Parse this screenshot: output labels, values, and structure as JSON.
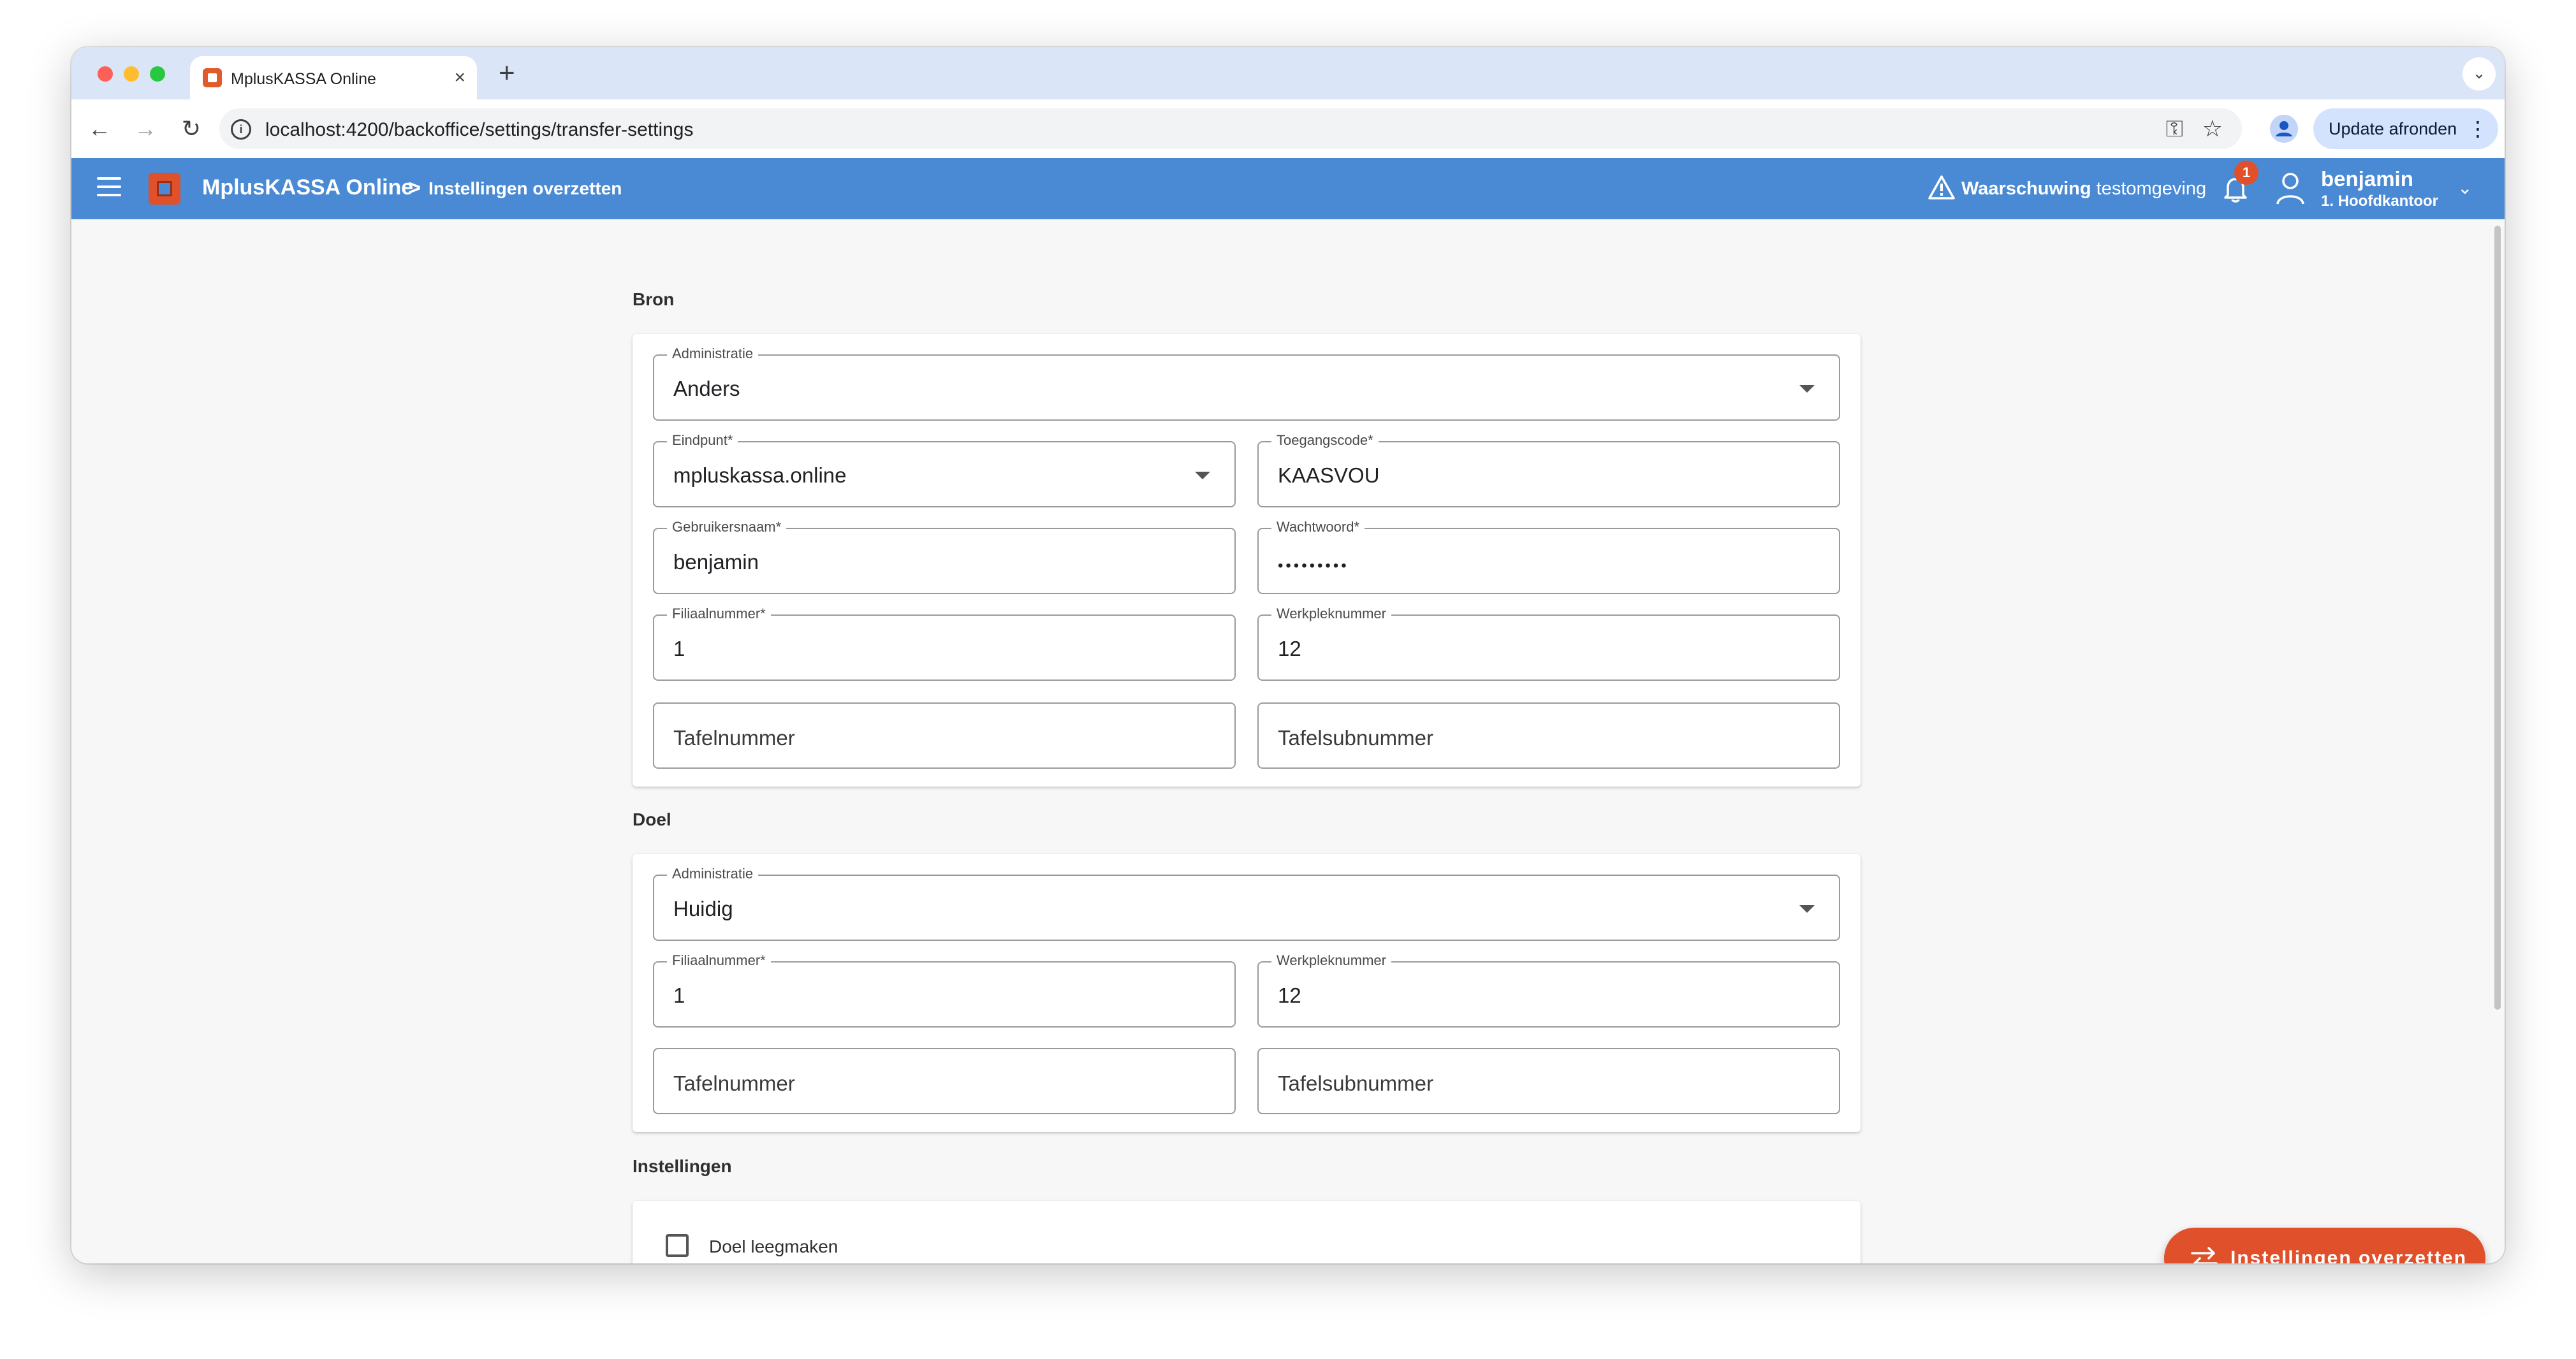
{
  "browser": {
    "tab_title": "MplusKASSA Online",
    "tab_close": "×",
    "new_tab": "+",
    "tab_overflow": "⌄",
    "back": "←",
    "forward": "→",
    "reload": "↻",
    "site_info": "i",
    "url": "localhost:4200/backoffice/settings/transfer-settings",
    "key_icon": "⚿",
    "star_icon": "☆",
    "profile_icon": "●",
    "update_label": "Update afronden",
    "update_menu": "⋮"
  },
  "header": {
    "app_name": "MplusKASSA Online",
    "breadcrumb_separator": ">",
    "breadcrumb_current": "Instellingen overzetten",
    "warning_bold": "Waarschuwing",
    "warning_text": " testomgeving",
    "notification_count": "1",
    "user_name": "benjamin",
    "user_branch": "1. Hoofdkantoor",
    "user_chevron": "⌄"
  },
  "source": {
    "title": "Bron",
    "administratie_label": "Administratie",
    "administratie_value": "Anders",
    "eindpunt_label": "Eindpunt*",
    "eindpunt_value": "mpluskassa.online",
    "toegangscode_label": "Toegangscode*",
    "toegangscode_value": "KAASVOU",
    "gebruikersnaam_label": "Gebruikersnaam*",
    "gebruikersnaam_value": "benjamin",
    "wachtwoord_label": "Wachtwoord*",
    "wachtwoord_value": "•••••••••",
    "filiaalnummer_label": "Filiaalnummer*",
    "filiaalnummer_value": "1",
    "werkpleknummer_label": "Werkpleknummer",
    "werkpleknummer_value": "12",
    "tafelnummer_placeholder": "Tafelnummer",
    "tafelsubnummer_placeholder": "Tafelsubnummer"
  },
  "target": {
    "title": "Doel",
    "administratie_label": "Administratie",
    "administratie_value": "Huidig",
    "filiaalnummer_label": "Filiaalnummer*",
    "filiaalnummer_value": "1",
    "werkpleknummer_label": "Werkpleknummer",
    "werkpleknummer_value": "12",
    "tafelnummer_placeholder": "Tafelnummer",
    "tafelsubnummer_placeholder": "Tafelsubnummer"
  },
  "settings": {
    "title": "Instellingen",
    "clear_target_label": "Doel leegmaken"
  },
  "actions": {
    "transfer_label": "Instellingen overzetten"
  },
  "colors": {
    "header_blue": "#4a8ad4",
    "brand_orange": "#e0502a"
  }
}
